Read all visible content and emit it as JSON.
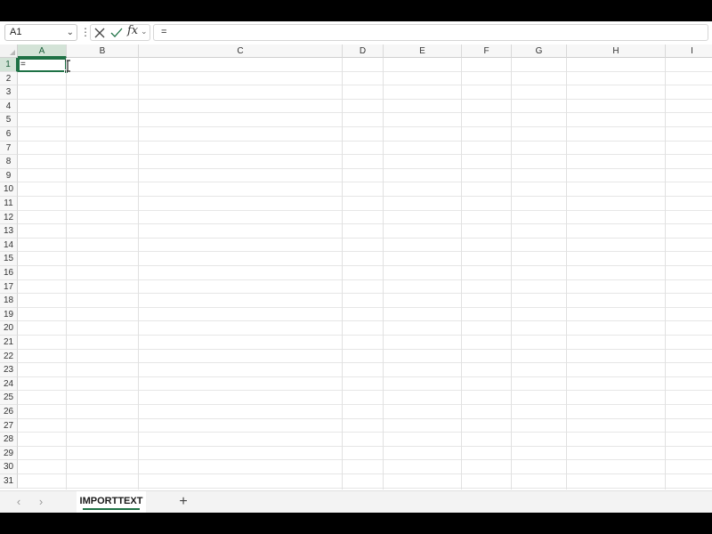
{
  "formula_bar": {
    "name_box": "A1",
    "name_box_dropdown_icon": "chevron-down-icon",
    "more_icon": "vertical-ellipsis-icon",
    "cancel_icon": "close-icon",
    "enter_icon": "check-icon",
    "fx_label": "fx",
    "fx_dropdown_icon": "chevron-down-icon",
    "formula": "="
  },
  "grid": {
    "columns": [
      "A",
      "B",
      "C",
      "D",
      "E",
      "F",
      "G",
      "H",
      "I"
    ],
    "selected_column": "A",
    "rows": [
      "1",
      "2",
      "3",
      "4",
      "5",
      "6",
      "7",
      "8",
      "9",
      "10",
      "11",
      "12",
      "13",
      "14",
      "15",
      "16",
      "17",
      "18",
      "19",
      "20",
      "21",
      "22",
      "23",
      "24",
      "25",
      "26",
      "27",
      "28",
      "29",
      "30",
      "31"
    ],
    "selected_row": "1",
    "active_cell": {
      "ref": "A1",
      "content": "="
    },
    "cursor_icon": "text-cursor-icon"
  },
  "sheet_tabs": {
    "prev_icon": "chevron-left-icon",
    "next_icon": "chevron-right-icon",
    "tabs": [
      {
        "label": "IMPORTTEXT",
        "active": true
      }
    ],
    "add_sheet_label": "+",
    "add_sheet_icon": "plus-icon"
  },
  "colors": {
    "accent": "#1e7145",
    "selected_header_bg": "#d3e3d7",
    "gridline": "#e1e1e1",
    "header_bg": "#f7f7f7",
    "frame": "#000000"
  }
}
